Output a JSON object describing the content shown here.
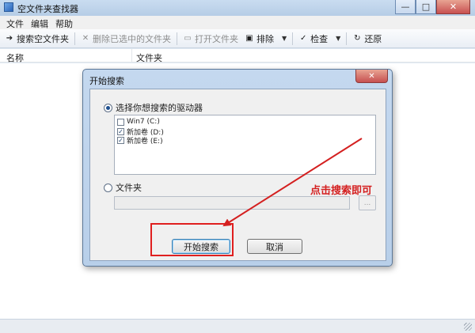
{
  "window": {
    "title": "空文件夹查找器",
    "minimize": "—",
    "maximize": "□",
    "close": "✕"
  },
  "menu": [
    "文件",
    "编辑",
    "帮助"
  ],
  "toolbar": {
    "search_empty": "搜索空文件夹",
    "delete_selected": "删除已选中的文件夹",
    "open_folder": "打开文件夹",
    "exclude": "排除",
    "check": "检查",
    "restore": "还原"
  },
  "list": {
    "columns": [
      "名称",
      "文件夹"
    ]
  },
  "dialog": {
    "title": "开始搜索",
    "close": "✕",
    "drive_option": "选择你想搜索的驱动器",
    "drives": [
      {
        "label": "Win7 (C:)",
        "checked": false
      },
      {
        "label": "新加卷 (D:)",
        "checked": true
      },
      {
        "label": "新加卷 (E:)",
        "checked": true
      }
    ],
    "folder_option": "文件夹",
    "folder_value": "",
    "browse_label": "...",
    "start_button": "开始搜索",
    "cancel_button": "取消"
  },
  "annotation": {
    "text": "点击搜索即可",
    "color": "#d42020"
  }
}
